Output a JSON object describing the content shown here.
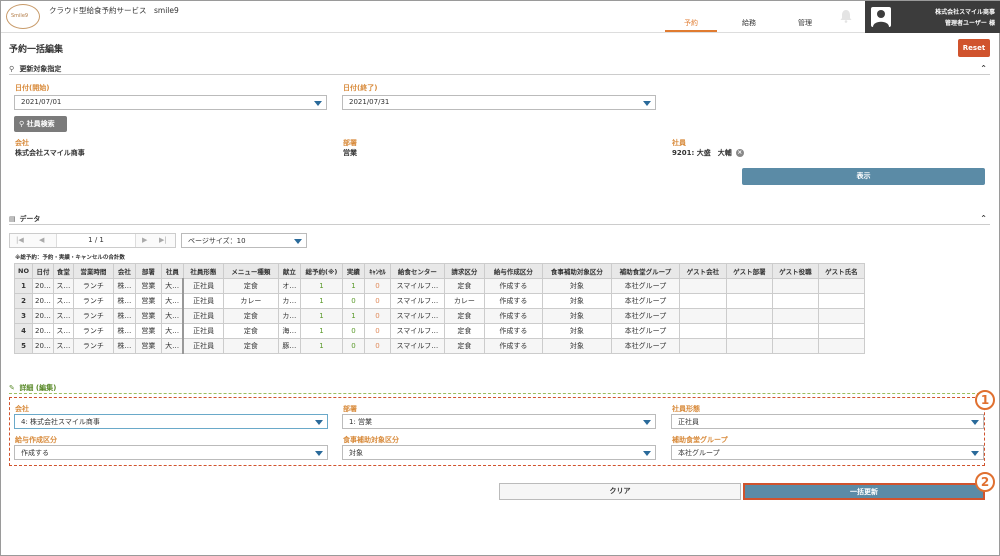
{
  "header": {
    "logo_text": "Smile9",
    "app_title": "クラウド型給食予約サービス　smile9",
    "nav": [
      "予約",
      "給務",
      "管理"
    ],
    "user_company": "株式会社スマイル商事",
    "user_name": "管理者ユーザー 様"
  },
  "page": {
    "title": "予約一括編集",
    "reset_label": "Reset"
  },
  "search": {
    "section_title": "更新対象指定",
    "date_start_label": "日付(開始)",
    "date_start_value": "2021/07/01",
    "date_end_label": "日付(終了)",
    "date_end_value": "2021/07/31",
    "employee_search_label": "社員検索",
    "company_label": "会社",
    "company_value": "株式会社スマイル商事",
    "dept_label": "部署",
    "dept_value": "営業",
    "employee_label": "社員",
    "employee_value": "9201:  大盛　大輔",
    "show_label": "表示"
  },
  "data_section": {
    "title": "データ",
    "pager_text": "1 / 1",
    "page_size": "ページサイズ：10",
    "note": "※総予約：予約・実績・キャンセルの合計数",
    "columns": [
      "NO",
      "日付",
      "食堂",
      "営業時間",
      "会社",
      "部署",
      "社員",
      "社員形態",
      "メニュー種類",
      "献立",
      "総予約(※)",
      "実績",
      "ｷｬﾝｾﾙ",
      "給食センター",
      "請求区分",
      "給与作成区分",
      "食事補助対象区分",
      "補助食堂グループ",
      "ゲスト会社",
      "ゲスト部署",
      "ゲスト役職",
      "ゲスト氏名"
    ],
    "rows": [
      [
        "1",
        "20…",
        "ス…",
        "ランチ",
        "株…",
        "営業",
        "大…",
        "正社員",
        "定食",
        "オ…",
        "1",
        "1",
        "0",
        "スマイルフ…",
        "定食",
        "作成する",
        "対象",
        "本社グループ",
        "",
        "",
        "",
        ""
      ],
      [
        "2",
        "20…",
        "ス…",
        "ランチ",
        "株…",
        "営業",
        "大…",
        "正社員",
        "カレー",
        "カ…",
        "1",
        "0",
        "0",
        "スマイルフ…",
        "カレー",
        "作成する",
        "対象",
        "本社グループ",
        "",
        "",
        "",
        ""
      ],
      [
        "3",
        "20…",
        "ス…",
        "ランチ",
        "株…",
        "営業",
        "大…",
        "正社員",
        "定食",
        "カ…",
        "1",
        "1",
        "0",
        "スマイルフ…",
        "定食",
        "作成する",
        "対象",
        "本社グループ",
        "",
        "",
        "",
        ""
      ],
      [
        "4",
        "20…",
        "ス…",
        "ランチ",
        "株…",
        "営業",
        "大…",
        "正社員",
        "定食",
        "海…",
        "1",
        "0",
        "0",
        "スマイルフ…",
        "定食",
        "作成する",
        "対象",
        "本社グループ",
        "",
        "",
        "",
        ""
      ],
      [
        "5",
        "20…",
        "ス…",
        "ランチ",
        "株…",
        "営業",
        "大…",
        "正社員",
        "定食",
        "豚…",
        "1",
        "0",
        "0",
        "スマイルフ…",
        "定食",
        "作成する",
        "対象",
        "本社グループ",
        "",
        "",
        "",
        ""
      ]
    ]
  },
  "detail": {
    "title": "詳細 (編集)",
    "company_label": "会社",
    "company_value": "4: 株式会社スマイル商事",
    "dept_label": "部署",
    "dept_value": "1: 営業",
    "emp_type_label": "社員形態",
    "emp_type_value": "正社員",
    "salary_label": "給与作成区分",
    "salary_value": "作成する",
    "meal_label": "食事補助対象区分",
    "meal_value": "対象",
    "group_label": "補助食堂グループ",
    "group_value": "本社グループ",
    "marker1": "1",
    "marker2": "2"
  },
  "actions": {
    "clear_label": "クリア",
    "bulk_update_label": "一括更新"
  },
  "colors": {
    "accent": "#e07b30",
    "primary_button": "#5b8ba6",
    "reset": "#d0532d",
    "label": "#d88a3a"
  }
}
